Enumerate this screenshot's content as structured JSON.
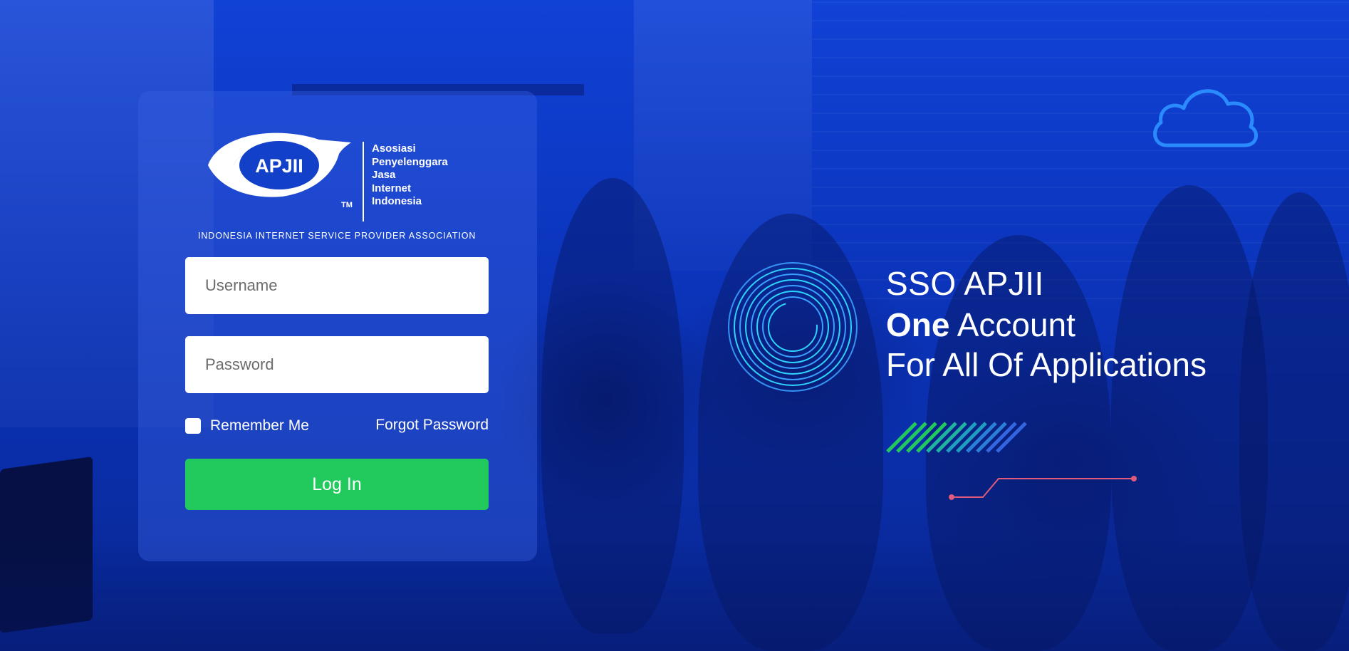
{
  "logo": {
    "mark_text": "APJII",
    "tm": "TM",
    "words": [
      "Asosiasi",
      "Penyelenggara",
      "Jasa",
      "Internet",
      "Indonesia"
    ],
    "tagline": "INDONESIA INTERNET SERVICE PROVIDER ASSOCIATION"
  },
  "login": {
    "username_placeholder": "Username",
    "password_placeholder": "Password",
    "remember_label": "Remember Me",
    "remember_checked": false,
    "forgot_label": "Forgot Password",
    "login_label": "Log In"
  },
  "hero": {
    "title": "SSO APJII",
    "line1_bold": "One",
    "line1_rest": " Account",
    "line2": "For All Of Applications"
  },
  "colors": {
    "background": "#0a2ca6",
    "card": "rgba(55,95,225,0.42)",
    "login_button": "#22c95c",
    "rings": "#3aa0ff",
    "cloud": "#2a8bff",
    "stripes": "#22c95c",
    "circuit": "#e05a7a"
  }
}
